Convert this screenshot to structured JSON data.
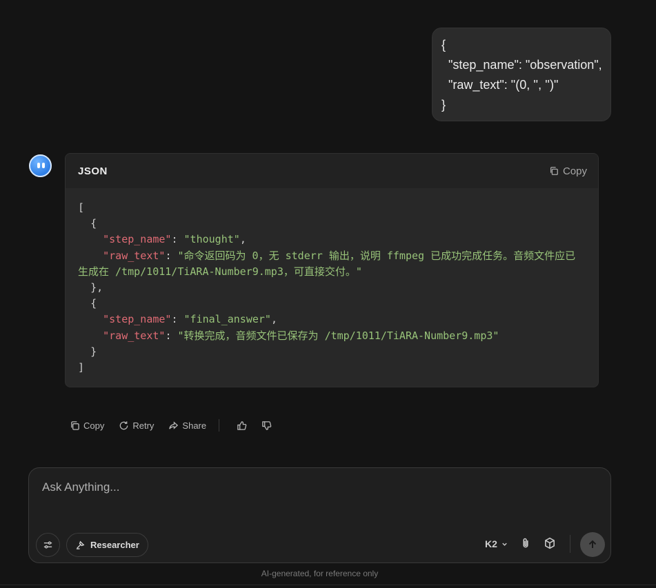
{
  "user_message": {
    "text": "{\n  \"step_name\": \"observation\",\n  \"raw_text\": \"(0, '', '')\"\n}"
  },
  "assistant": {
    "avatar_icon": "smiley-bot-icon",
    "code_block": {
      "language": "JSON",
      "copy_label": "Copy",
      "lines": [
        {
          "t": "["
        },
        {
          "t": "  {"
        },
        {
          "indent": "    ",
          "key": "\"step_name\"",
          "sep": ": ",
          "val": "\"thought\"",
          "end": ","
        },
        {
          "indent": "    ",
          "key": "\"raw_text\"",
          "sep": ": ",
          "val": "\"命令返回码为 0，无 stderr 输出，说明 ffmpeg 已成功完成任务。音频文件应已生成在 /tmp/1011/TiARA-Number9.mp3，可直接交付。\"",
          "end": ""
        },
        {
          "t": "  },"
        },
        {
          "t": "  {"
        },
        {
          "indent": "    ",
          "key": "\"step_name\"",
          "sep": ": ",
          "val": "\"final_answer\"",
          "end": ","
        },
        {
          "indent": "    ",
          "key": "\"raw_text\"",
          "sep": ": ",
          "val": "\"转换完成，音频文件已保存为 /tmp/1011/TiARA-Number9.mp3\"",
          "end": ""
        },
        {
          "t": "  }"
        },
        {
          "t": "]"
        }
      ]
    },
    "actions": {
      "copy": "Copy",
      "retry": "Retry",
      "share": "Share"
    }
  },
  "composer": {
    "placeholder": "Ask Anything...",
    "researcher_label": "Researcher",
    "model_label": "K2"
  },
  "disclaimer": "AI-generated, for reference only",
  "colors": {
    "background": "#141414",
    "json_key": "#e06c75",
    "json_string": "#98c379"
  }
}
